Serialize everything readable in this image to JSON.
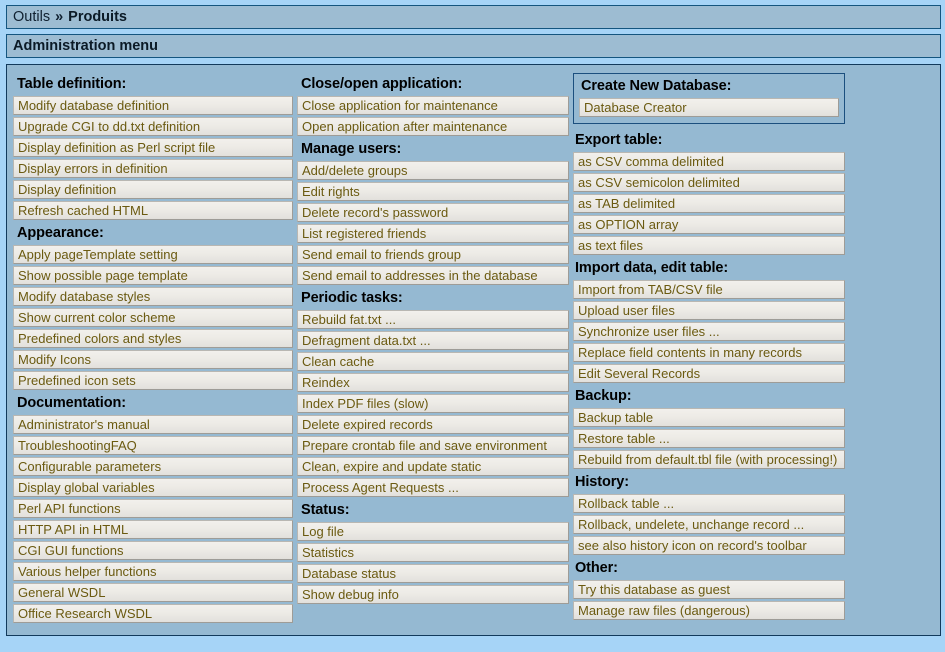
{
  "breadcrumb": {
    "root": "Outils",
    "separator": "»",
    "current": "Produits"
  },
  "page_title": "Administration menu",
  "columns": [
    {
      "id": "column-1",
      "groups": [
        {
          "heading": "Table definition:",
          "items": [
            "Modify database definition",
            "Upgrade CGI to dd.txt definition",
            "Display definition as Perl script file",
            "Display errors in definition",
            "Display definition",
            "Refresh cached HTML"
          ]
        },
        {
          "heading": "Appearance:",
          "items": [
            "Apply pageTemplate setting",
            "Show possible page template",
            "Modify database styles",
            "Show current color scheme",
            "Predefined colors and styles",
            "Modify Icons",
            "Predefined icon sets"
          ]
        },
        {
          "heading": "Documentation:",
          "items": [
            "Administrator's manual",
            "TroubleshootingFAQ",
            "Configurable parameters",
            "Display global variables",
            "Perl API functions",
            "HTTP API in HTML",
            "CGI GUI functions",
            "Various helper functions",
            "General WSDL",
            "Office Research WSDL"
          ]
        }
      ]
    },
    {
      "id": "column-2",
      "groups": [
        {
          "heading": "Close/open application:",
          "items": [
            "Close application for maintenance",
            "Open application after maintenance"
          ]
        },
        {
          "heading": "Manage users:",
          "items": [
            "Add/delete groups",
            "Edit rights",
            "Delete record's password",
            "List registered friends",
            "Send email to friends group",
            "Send email to addresses in the database"
          ]
        },
        {
          "heading": "Periodic tasks:",
          "items": [
            "Rebuild fat.txt ...",
            "Defragment data.txt ...",
            "Clean cache",
            "Reindex",
            "Index PDF files (slow)",
            "Delete expired records",
            "Prepare crontab file and save environment",
            "Clean, expire and update static",
            "Process Agent Requests ..."
          ]
        },
        {
          "heading": "Status:",
          "items": [
            "Log file",
            "Statistics",
            "Database status",
            "Show debug info"
          ]
        }
      ]
    },
    {
      "id": "column-3",
      "boxed_group": {
        "heading": "Create New Database:",
        "items": [
          "Database Creator"
        ]
      },
      "groups": [
        {
          "heading": "Export table:",
          "items": [
            "as CSV comma delimited",
            "as CSV semicolon delimited",
            "as TAB delimited",
            "as OPTION array",
            "as text files"
          ]
        },
        {
          "heading": "Import data, edit table:",
          "items": [
            "Import from TAB/CSV file",
            "Upload user files",
            "Synchronize user files ...",
            "Replace field contents in many records",
            "Edit Several Records"
          ]
        },
        {
          "heading": "Backup:",
          "items": [
            "Backup table",
            "Restore table ...",
            "Rebuild from default.tbl file (with processing!)"
          ]
        },
        {
          "heading": "History:",
          "items": [
            "Rollback table ...",
            "Rollback, undelete, unchange record ...",
            "see also history icon on record's toolbar"
          ]
        },
        {
          "heading": "Other:",
          "items": [
            "Try this database as guest",
            "Manage raw files (dangerous)"
          ]
        }
      ]
    }
  ],
  "colors": {
    "page_background": "#a6d4f7",
    "panel_background": "#95b9d2",
    "panel_border": "#123a5c",
    "bar_background": "#9dbcd2",
    "bar_border": "#14557f",
    "item_text": "#6b5a10",
    "heading_text": "#000000"
  }
}
